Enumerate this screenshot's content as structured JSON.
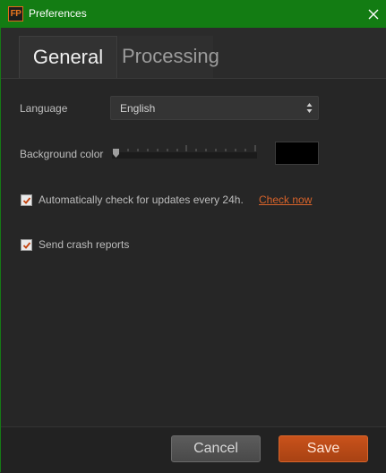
{
  "window": {
    "title": "Preferences",
    "app_icon_text": "FP",
    "accent_color": "#137c13"
  },
  "tabs": [
    {
      "label": "General",
      "selected": true
    },
    {
      "label": "Processing",
      "selected": false
    }
  ],
  "general": {
    "language": {
      "label": "Language",
      "value": "English"
    },
    "background_color": {
      "label": "Background color",
      "slider_value": 0,
      "swatch_color": "#000000"
    },
    "auto_update": {
      "label": "Automatically check for updates every 24h.",
      "checked": true,
      "link_label": "Check now"
    },
    "crash_reports": {
      "label": "Send crash reports",
      "checked": true
    }
  },
  "footer": {
    "cancel_label": "Cancel",
    "save_label": "Save"
  },
  "icons": {
    "close": "close-icon",
    "select_arrows": "updown-arrows-icon",
    "checkmark": "checkmark-icon"
  },
  "colors": {
    "link": "#d8632a",
    "save_button": "#b84a17"
  }
}
